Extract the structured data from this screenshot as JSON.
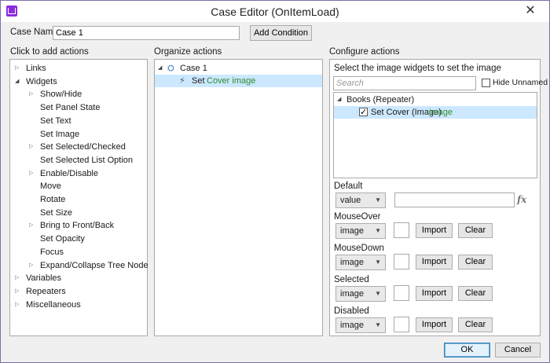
{
  "window": {
    "title": "Case Editor (OnItemLoad)",
    "close": "✕"
  },
  "case_name": {
    "label": "Case Name",
    "value": "Case 1",
    "add_condition": "Add Condition"
  },
  "left": {
    "heading": "Click to add actions",
    "items": [
      {
        "label": "Links",
        "level": 0,
        "expander": "closed"
      },
      {
        "label": "Widgets",
        "level": 0,
        "expander": "open"
      },
      {
        "label": "Show/Hide",
        "level": 1,
        "expander": "closed"
      },
      {
        "label": "Set Panel State",
        "level": 1,
        "expander": "none"
      },
      {
        "label": "Set Text",
        "level": 1,
        "expander": "none"
      },
      {
        "label": "Set Image",
        "level": 1,
        "expander": "none"
      },
      {
        "label": "Set Selected/Checked",
        "level": 1,
        "expander": "closed"
      },
      {
        "label": "Set Selected List Option",
        "level": 1,
        "expander": "none"
      },
      {
        "label": "Enable/Disable",
        "level": 1,
        "expander": "closed"
      },
      {
        "label": "Move",
        "level": 1,
        "expander": "none"
      },
      {
        "label": "Rotate",
        "level": 1,
        "expander": "none"
      },
      {
        "label": "Set Size",
        "level": 1,
        "expander": "none"
      },
      {
        "label": "Bring to Front/Back",
        "level": 1,
        "expander": "closed"
      },
      {
        "label": "Set Opacity",
        "level": 1,
        "expander": "none"
      },
      {
        "label": "Focus",
        "level": 1,
        "expander": "none"
      },
      {
        "label": "Expand/Collapse Tree Node",
        "level": 1,
        "expander": "closed"
      },
      {
        "label": "Variables",
        "level": 0,
        "expander": "closed"
      },
      {
        "label": "Repeaters",
        "level": 0,
        "expander": "closed"
      },
      {
        "label": "Miscellaneous",
        "level": 0,
        "expander": "closed"
      }
    ]
  },
  "middle": {
    "heading": "Organize actions",
    "case_label": "Case 1",
    "action_prefix": "Set",
    "action_target": "Cover image"
  },
  "right": {
    "heading": "Configure actions",
    "instruction": "Select the image widgets to set the image",
    "search_placeholder": "Search",
    "hide_unnamed": "Hide Unnamed",
    "repeater_label": "Books (Repeater)",
    "widget_label": "Set Cover (Image)",
    "widget_tag": "image",
    "states": [
      {
        "label": "Default",
        "dropdown": "value",
        "kind": "value"
      },
      {
        "label": "MouseOver",
        "dropdown": "image",
        "kind": "image"
      },
      {
        "label": "MouseDown",
        "dropdown": "image",
        "kind": "image"
      },
      {
        "label": "Selected",
        "dropdown": "image",
        "kind": "image"
      },
      {
        "label": "Disabled",
        "dropdown": "image",
        "kind": "image"
      }
    ],
    "import_label": "Import",
    "clear_label": "Clear",
    "fx_label": "fx"
  },
  "footer": {
    "ok": "OK",
    "cancel": "Cancel"
  },
  "colors": {
    "accent": "#3c7fb1",
    "selection": "#cce8ff",
    "green_text": "#2e8b2e",
    "app_icon": "#8a2be2"
  }
}
